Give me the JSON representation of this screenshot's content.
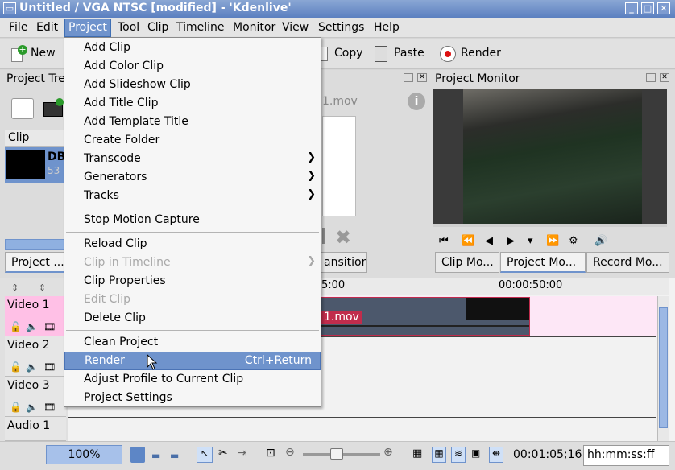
{
  "window": {
    "title": "Untitled / VGA NTSC [modified] - 'Kdenlive'"
  },
  "menubar": [
    "File",
    "Edit",
    "Project",
    "Tool",
    "Clip",
    "Timeline",
    "Monitor",
    "View",
    "Settings",
    "Help"
  ],
  "toolbar": {
    "new_label": "New",
    "copy_label": "Copy",
    "paste_label": "Paste",
    "render_label": "Render"
  },
  "project_tree": {
    "title": "Project Tree",
    "column": "Clip",
    "clip_name": "DB",
    "clip_sub": "53",
    "tab_label": "Project ..."
  },
  "clip_panel": {
    "filename": "1.mov",
    "transition_tab": "ansition"
  },
  "monitor": {
    "title": "Project Monitor",
    "tabs": [
      "Clip Mo...",
      "Project Mo...",
      "Record Mo..."
    ]
  },
  "timeline": {
    "ruler": [
      "5:00",
      "00:00:50:00"
    ],
    "clip_label": "1.mov",
    "tracks": [
      "Video 1",
      "Video 2",
      "Video 3",
      "Audio 1"
    ]
  },
  "project_menu": {
    "items": [
      {
        "label": "Add Clip"
      },
      {
        "label": "Add Color Clip"
      },
      {
        "label": "Add Slideshow Clip"
      },
      {
        "label": "Add Title Clip"
      },
      {
        "label": "Add Template Title"
      },
      {
        "label": "Create Folder"
      },
      {
        "label": "Transcode"
      },
      {
        "label": "Generators"
      },
      {
        "label": "Tracks"
      },
      {
        "label": "Stop Motion Capture"
      },
      {
        "label": "Reload Clip"
      },
      {
        "label": "Clip in Timeline"
      },
      {
        "label": "Clip Properties"
      },
      {
        "label": "Edit Clip"
      },
      {
        "label": "Delete Clip"
      },
      {
        "label": "Clean Project"
      },
      {
        "label": "Render",
        "shortcut": "Ctrl+Return"
      },
      {
        "label": "Adjust Profile to Current Clip"
      },
      {
        "label": "Project Settings"
      }
    ]
  },
  "statusbar": {
    "zoom": "100%",
    "timecode": "00:01:05;16",
    "format": "hh:mm:ss:ff"
  }
}
